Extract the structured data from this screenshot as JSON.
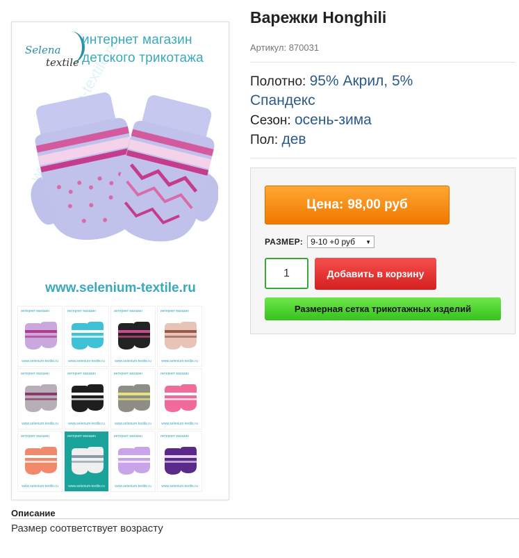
{
  "product": {
    "title": "Варежки Honghili",
    "sku_label": "Артикул:",
    "sku_value": "870031",
    "properties": [
      {
        "label": "Полотно:",
        "value": "95% Акрил, 5% Спандекс"
      },
      {
        "label": "Сезон:",
        "value": "осень-зима"
      },
      {
        "label": "Пол:",
        "value": "дев"
      }
    ]
  },
  "gallery": {
    "logo_selena": "Selena",
    "logo_textile": "textile",
    "shop_line1": "интернет магазин",
    "shop_line2": "детского трикотажа",
    "watermark": "www.selenium-textile.ru",
    "site_url": "www.selenium-textile.ru",
    "thumbnails": [
      {
        "color": "#c9a8e0",
        "accent": "#b63a8a"
      },
      {
        "color": "#3fc2d8",
        "accent": "#ffffff"
      },
      {
        "color": "#222222",
        "accent": "#d04a8a"
      },
      {
        "color": "#e8c3b8",
        "accent": "#9a5a4a"
      },
      {
        "color": "#b8aeb8",
        "accent": "#8a3a6a"
      },
      {
        "color": "#1e1e1e",
        "accent": "#ffffff"
      },
      {
        "color": "#8e8e86",
        "accent": "#e8e27a"
      },
      {
        "color": "#f06a9a",
        "accent": "#ffffff"
      },
      {
        "color": "#f08a6a",
        "accent": "#ffffff"
      },
      {
        "color": "#f0f0f0",
        "accent": "#8a9aa8"
      },
      {
        "color": "#c8a4e8",
        "accent": "#ffffff"
      },
      {
        "color": "#5a2a8a",
        "accent": "#e8d0f0"
      }
    ]
  },
  "buy": {
    "price_label": "Цена:",
    "price_value": "98,00 руб",
    "size_label": "РАЗМЕР:",
    "size_selected": "9-10 +0 руб",
    "quantity": "1",
    "add_to_cart": "Добавить в корзину",
    "size_chart": "Размерная сетка трикотажных изделий"
  },
  "description": {
    "heading": "Описание",
    "text": "Размер соответствует возрасту"
  },
  "colors": {
    "price_orange": "#f58a00",
    "cart_red": "#e03030",
    "size_chart_green": "#4ed22a",
    "qty_border_green": "#3aa63a",
    "link_blue": "#2a5a8a",
    "brand_teal": "#3aa8be"
  }
}
